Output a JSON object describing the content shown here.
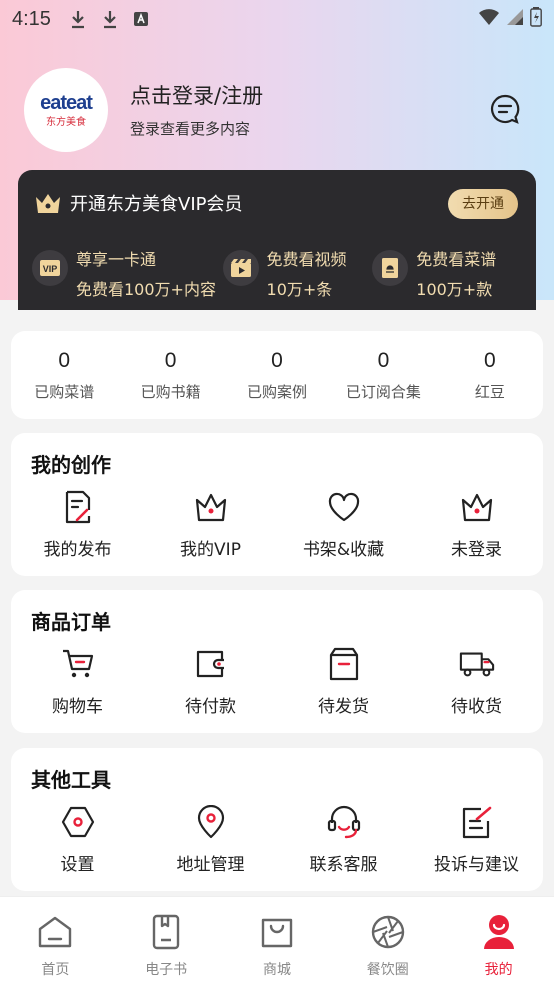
{
  "status_bar": {
    "time": "4:15",
    "icons": [
      "download-icon",
      "download-icon",
      "font-icon",
      "wifi-icon",
      "signal-icon",
      "battery-icon"
    ]
  },
  "profile": {
    "logo_text_main": "eateat",
    "logo_text_sub": "东方美食",
    "login_title": "点击登录/注册",
    "login_subtitle": "登录查看更多内容",
    "message_icon": "message-icon"
  },
  "vip": {
    "title": "开通东方美食VIP会员",
    "button_label": "去开通",
    "perks": [
      {
        "icon": "vip-card-icon",
        "line1": "尊享一卡通",
        "line2": "免费看100万+内容"
      },
      {
        "icon": "video-icon",
        "line1": "免费看视频",
        "line2": "10万+条"
      },
      {
        "icon": "recipe-book-icon",
        "line1": "免费看菜谱",
        "line2": "100万+款"
      }
    ],
    "colors": {
      "card": "#2b2a2d",
      "gold": "#f1dcb0"
    }
  },
  "stats": [
    {
      "value": "0",
      "label": "已购菜谱"
    },
    {
      "value": "0",
      "label": "已购书籍"
    },
    {
      "value": "0",
      "label": "已购案例"
    },
    {
      "value": "0",
      "label": "已订阅合集"
    },
    {
      "value": "0",
      "label": "红豆"
    }
  ],
  "creation": {
    "title": "我的创作",
    "items": [
      {
        "icon": "edit-document-icon",
        "label": "我的发布"
      },
      {
        "icon": "crown-icon",
        "label": "我的VIP"
      },
      {
        "icon": "heart-icon",
        "label": "书架&收藏"
      },
      {
        "icon": "crown-icon",
        "label": "未登录"
      }
    ]
  },
  "orders": {
    "title": "商品订单",
    "items": [
      {
        "icon": "cart-icon",
        "label": "购物车"
      },
      {
        "icon": "wallet-icon",
        "label": "待付款"
      },
      {
        "icon": "package-icon",
        "label": "待发货"
      },
      {
        "icon": "truck-icon",
        "label": "待收货"
      }
    ]
  },
  "tools": {
    "title": "其他工具",
    "items": [
      {
        "icon": "settings-icon",
        "label": "设置"
      },
      {
        "icon": "location-icon",
        "label": "地址管理"
      },
      {
        "icon": "headset-icon",
        "label": "联系客服"
      },
      {
        "icon": "feedback-icon",
        "label": "投诉与建议"
      }
    ]
  },
  "tabbar": [
    {
      "icon": "home-icon",
      "label": "首页",
      "active": false
    },
    {
      "icon": "ebook-icon",
      "label": "电子书",
      "active": false
    },
    {
      "icon": "shopping-bag-icon",
      "label": "商城",
      "active": false
    },
    {
      "icon": "aperture-icon",
      "label": "餐饮圈",
      "active": false
    },
    {
      "icon": "profile-icon",
      "label": "我的",
      "active": true
    }
  ],
  "colors": {
    "accent": "#e8213a",
    "icon": "#222222"
  }
}
